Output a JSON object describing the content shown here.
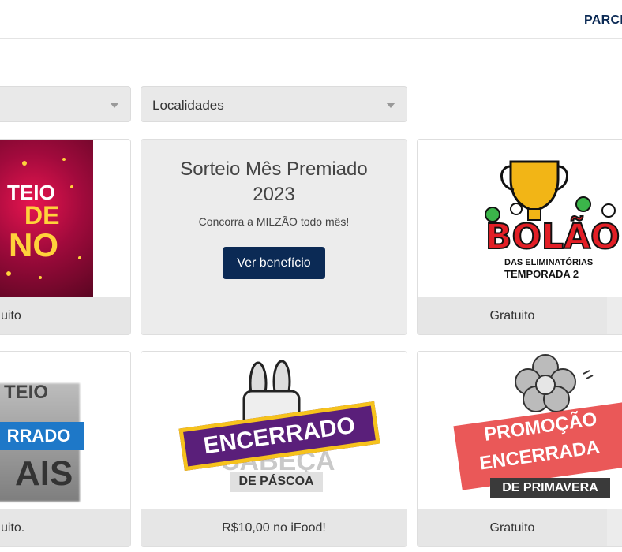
{
  "header": {
    "nav_partial": "PARCI"
  },
  "filters": {
    "first": {
      "value": ""
    },
    "localidades": {
      "value": "Localidades"
    }
  },
  "cards": [
    {
      "footer": "uito",
      "image_text": [
        "TEIO",
        "DE",
        "NO"
      ]
    },
    {
      "title": "Sorteio Mês Premiado 2023",
      "description": "Concorra a MILZÃO todo mês!",
      "button": "Ver benefício"
    },
    {
      "footer": "Gratuito",
      "image_text": [
        "BOLÃO",
        "DAS ELIMINATÓRIAS",
        "TEMPORADA 2"
      ]
    },
    {
      "footer": "uito.",
      "image_text": [
        "TEIO",
        "RRADO",
        "AIS"
      ]
    },
    {
      "footer": "R$10,00 no iFood!",
      "image_text": [
        "ENCERRADO",
        "CABEÇA",
        "DE PÁSCOA"
      ]
    },
    {
      "footer": "Gratuito",
      "image_text": [
        "PROMOÇÃO",
        "ENCERRADA",
        "DE PRIMAVERA"
      ]
    }
  ],
  "colors": {
    "navy": "#0b2a55",
    "card_bg": "#ececec",
    "encerrado_purple": "#5a1f7a",
    "encerrado_yellow": "#f6c21c",
    "promo_red": "#e84a4a"
  }
}
